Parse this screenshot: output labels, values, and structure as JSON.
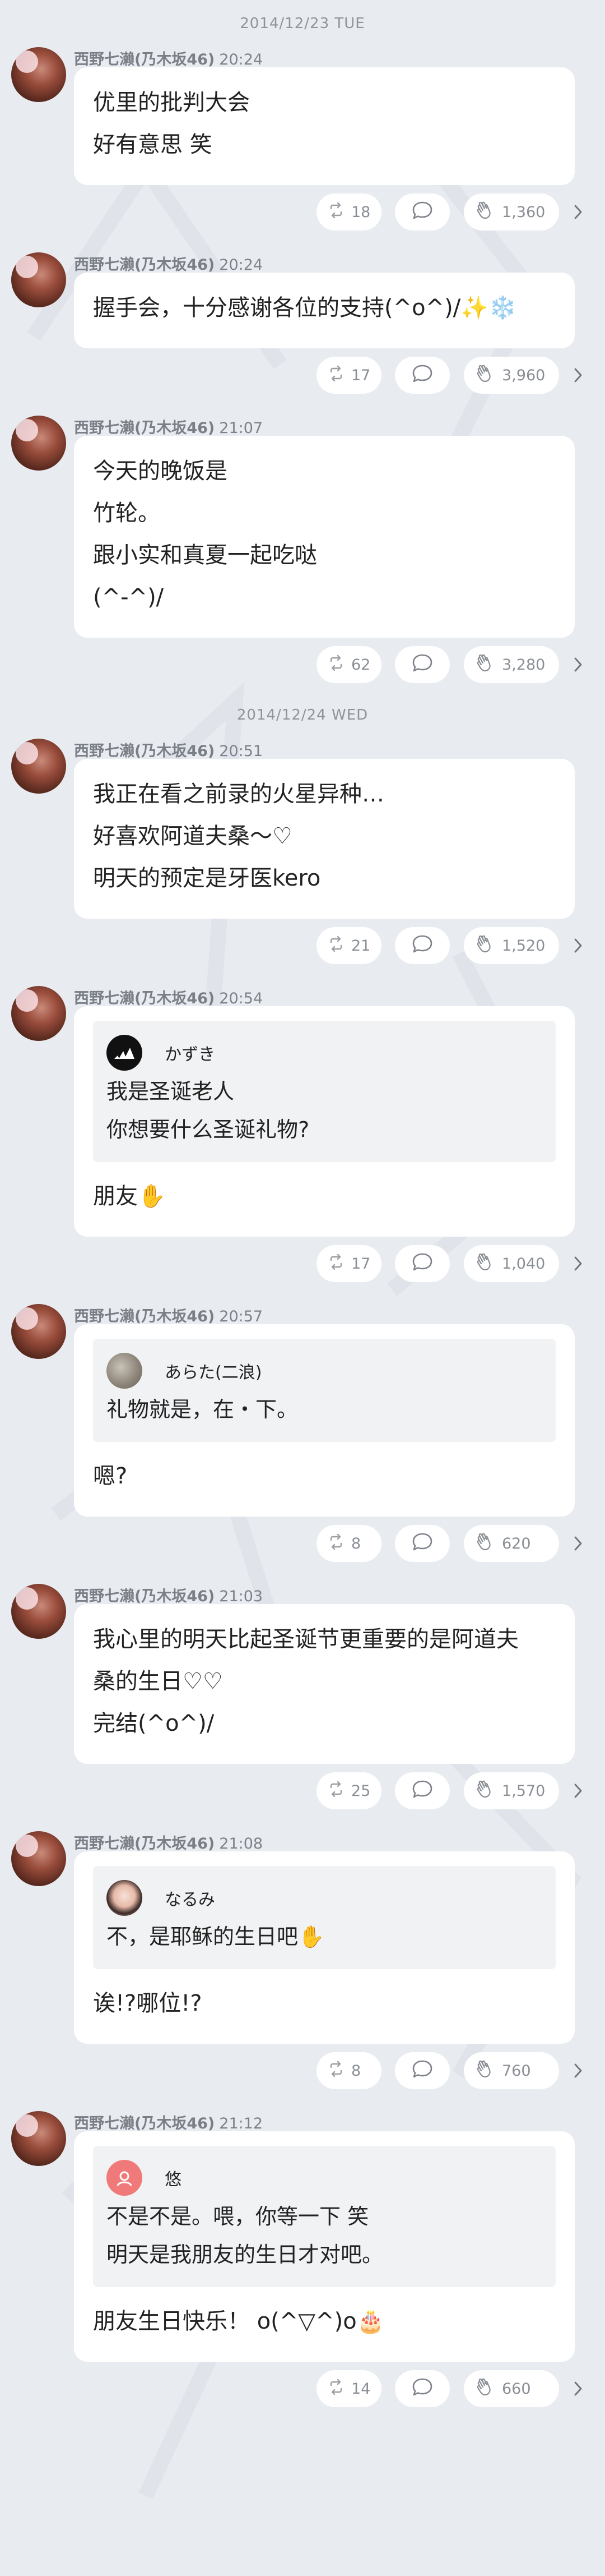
{
  "author": {
    "name": "西野七濑(乃木坂46)"
  },
  "dates": [
    "2014/12/23 TUE",
    "2014/12/24 WED"
  ],
  "posts": [
    {
      "time": "20:24",
      "lines": [
        "优里的批判大会",
        "好有意思 笑"
      ],
      "reposts": "18",
      "likes": "1,360"
    },
    {
      "time": "20:24",
      "lines": [
        "握手会，十分感谢各位的支持(^o^)/✨❄️"
      ],
      "reposts": "17",
      "likes": "3,960"
    },
    {
      "time": "21:07",
      "lines": [
        "今天的晚饭是",
        "竹轮。",
        "跟小实和真夏一起吃哒",
        "(^-^)/"
      ],
      "reposts": "62",
      "likes": "3,280"
    },
    {
      "time": "20:51",
      "lines": [
        "我正在看之前录的火星异种…",
        "好喜欢阿道夫桑〜♡",
        "明天的预定是牙医kero"
      ],
      "reposts": "21",
      "likes": "1,520"
    },
    {
      "time": "20:54",
      "quote": {
        "name": "かずき",
        "lines": [
          "我是圣诞老人",
          "你想要什么圣诞礼物?"
        ]
      },
      "lines": [
        "朋友✋"
      ],
      "reposts": "17",
      "likes": "1,040"
    },
    {
      "time": "20:57",
      "quote": {
        "name": "あらた(二浪)",
        "lines": [
          "礼物就是，在・下。"
        ]
      },
      "lines": [
        "嗯?"
      ],
      "reposts": "8",
      "likes": "620"
    },
    {
      "time": "21:03",
      "lines": [
        "我心里的明天比起圣诞节更重要的是阿道夫",
        "桑的生日♡♡",
        "完结(^o^)/"
      ],
      "reposts": "25",
      "likes": "1,570"
    },
    {
      "time": "21:08",
      "quote": {
        "name": "なるみ",
        "lines": [
          "不，是耶稣的生日吧✋"
        ]
      },
      "lines": [
        "诶!?哪位!?"
      ],
      "reposts": "8",
      "likes": "760"
    },
    {
      "time": "21:12",
      "quote": {
        "name": "悠",
        "lines": [
          "不是不是。喂，你等一下 笑",
          "明天是我朋友的生日才对吧。"
        ]
      },
      "lines": [
        "朋友生日快乐！ o(^▽^)o🎂"
      ],
      "reposts": "14",
      "likes": "660"
    }
  ],
  "colors": {
    "background": "#e8ebf0",
    "bubble": "#ffffff",
    "meta": "#7d8189",
    "quote_bg": "#f1f2f4"
  },
  "icons": [
    "repost-icon",
    "comment-icon",
    "clap-icon",
    "chevron-right-icon",
    "adidas-logo-icon"
  ]
}
